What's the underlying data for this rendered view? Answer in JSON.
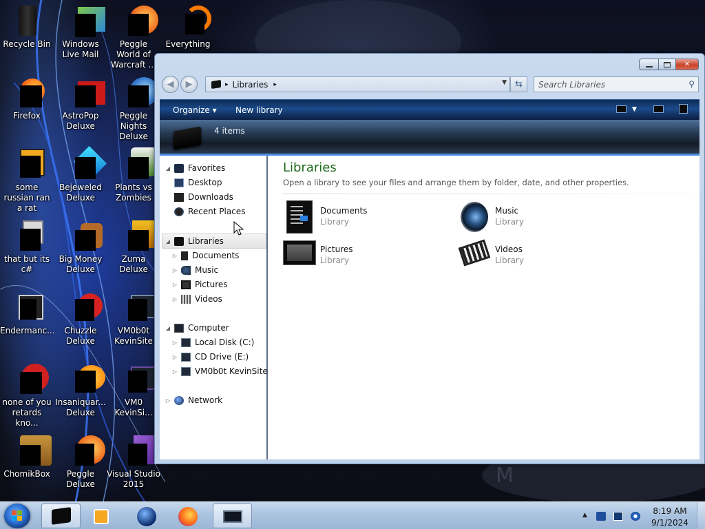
{
  "desktop": {
    "icons": [
      {
        "label": "Recycle Bin"
      },
      {
        "label": "Windows Live Mail"
      },
      {
        "label": "Peggle World of Warcraft ..."
      },
      {
        "label": "Everything"
      },
      {
        "label": "Firefox"
      },
      {
        "label": "AstroPop Deluxe"
      },
      {
        "label": "Peggle Nights Deluxe"
      },
      {
        "label": "some russian ran a rat"
      },
      {
        "label": "Bejeweled Deluxe"
      },
      {
        "label": "Plants vs Zombies"
      },
      {
        "label": "that but its c#"
      },
      {
        "label": "Big Money Deluxe"
      },
      {
        "label": "Zuma Deluxe"
      },
      {
        "label": "Endermanc..."
      },
      {
        "label": "Chuzzle Deluxe"
      },
      {
        "label": "VM0b0t KevinSite"
      },
      {
        "label": "none of you retards kno..."
      },
      {
        "label": "Insaniquar... Deluxe"
      },
      {
        "label": "VM0 KevinSi..."
      },
      {
        "label": "ChomikBox"
      },
      {
        "label": "Peggle Deluxe"
      },
      {
        "label": "Visual Studio 2015"
      }
    ]
  },
  "explorer": {
    "address": {
      "crumb": "Libraries",
      "sep": "▸"
    },
    "search_placeholder": "Search Libraries",
    "toolbar": {
      "organize": "Organize ▾",
      "new_library": "New library"
    },
    "info": {
      "count": "4 items"
    },
    "nav": {
      "favorites": "Favorites",
      "desktop": "Desktop",
      "downloads": "Downloads",
      "recent": "Recent Places",
      "libraries": "Libraries",
      "documents": "Documents",
      "music": "Music",
      "pictures": "Pictures",
      "videos": "Videos",
      "computer": "Computer",
      "local_disk": "Local Disk (C:)",
      "cd_drive": "CD Drive (E:)",
      "vm": "VM0b0t KevinSite",
      "network": "Network"
    },
    "content": {
      "title": "Libraries",
      "subtitle": "Open a library to see your files and arrange them by folder, date, and other properties.",
      "items": [
        {
          "name": "Documents",
          "type": "Library"
        },
        {
          "name": "Music",
          "type": "Library"
        },
        {
          "name": "Pictures",
          "type": "Library"
        },
        {
          "name": "Videos",
          "type": "Library"
        }
      ]
    }
  },
  "taskbar": {
    "time": "8:19 AM",
    "date": "9/1/2024"
  },
  "colors": {
    "accent": "#1e6b1e",
    "cmdbar": "#1a4a8a",
    "taskbar": "#a9c2df"
  }
}
